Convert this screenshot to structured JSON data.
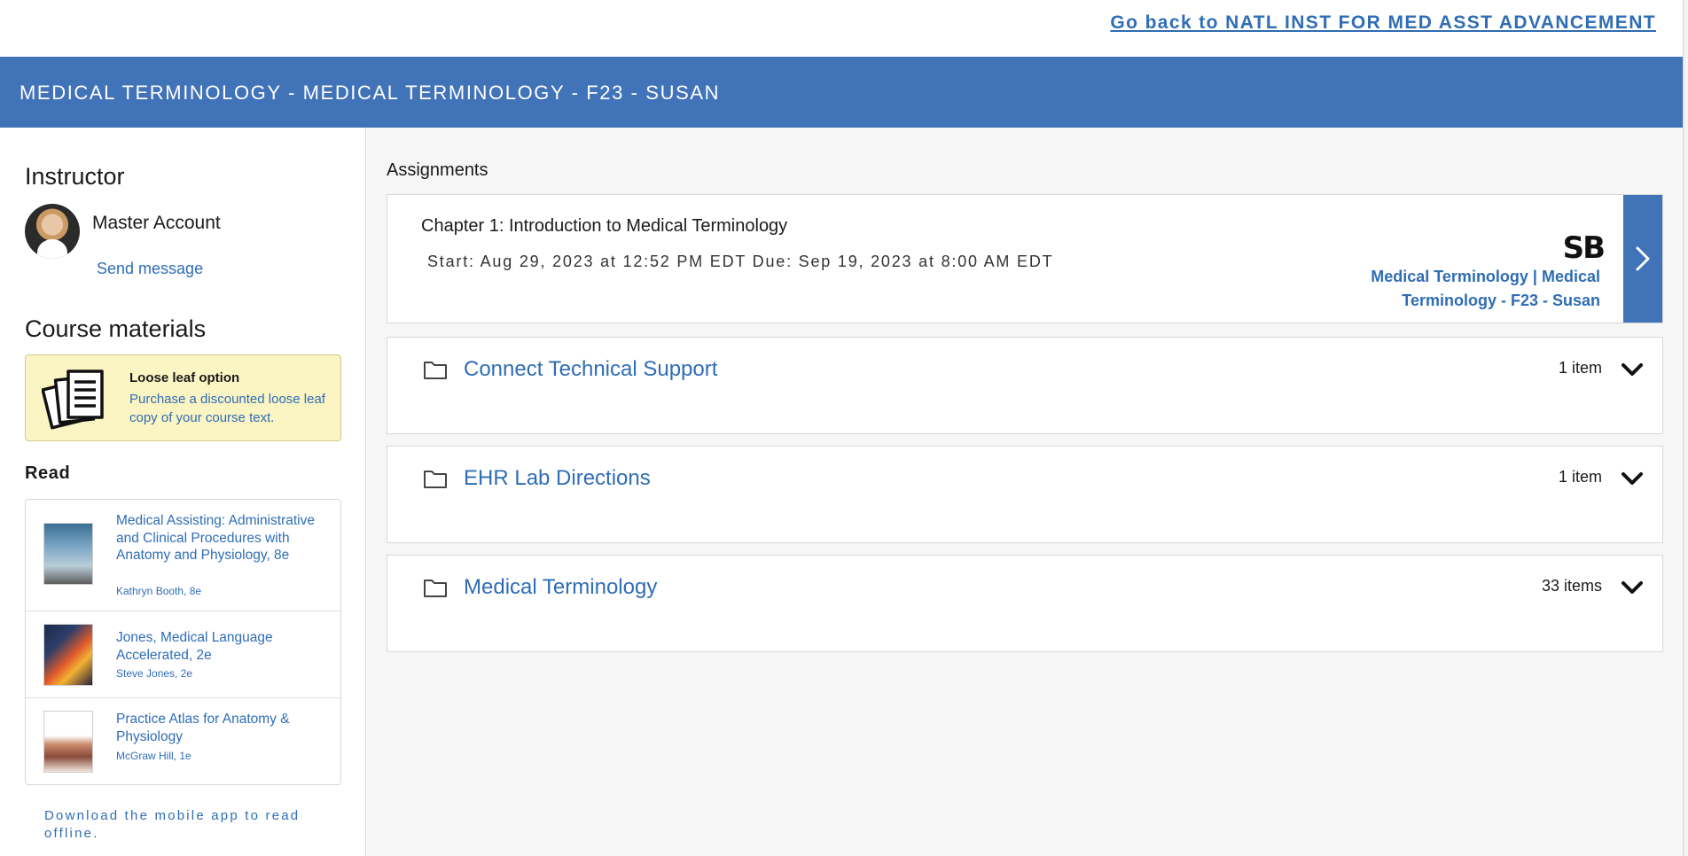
{
  "topbar": {
    "back_link": "Go back to NATL INST FOR MED ASST ADVANCEMENT"
  },
  "header": {
    "course_title": "MEDICAL TERMINOLOGY - MEDICAL TERMINOLOGY - F23 - SUSAN"
  },
  "sidebar": {
    "instructor": {
      "heading": "Instructor",
      "name": "Master Account",
      "send_message": "Send message",
      "avatar_icon": "instructor-avatar"
    },
    "course_materials": {
      "heading": "Course materials",
      "loose_leaf": {
        "icon": "loose-leaf-pages-icon",
        "heading": "Loose leaf option",
        "text": "Purchase a discounted loose leaf copy of your course text."
      }
    },
    "read": {
      "heading": "Read",
      "books": [
        {
          "title": "Medical Assisting: Administrative and Clinical Procedures with Anatomy and Physiology, 8e",
          "author": "Kathryn Booth, 8e",
          "cover_color": "#4a7fa8"
        },
        {
          "title": "Jones, Medical Language Accelerated, 2e",
          "author": "Steve Jones, 2e",
          "cover_color": "#c0392b"
        },
        {
          "title": "Practice Atlas for Anatomy & Physiology",
          "author": "McGraw Hill, 1e",
          "cover_color": "#2f6db5"
        }
      ]
    },
    "mobile_note": "Download the mobile app to read offline."
  },
  "main": {
    "assignments_label": "Assignments",
    "assignment": {
      "title": "Chapter 1: Introduction to Medical Terminology",
      "dates": "Start: Aug 29, 2023 at 12:52 PM EDT  Due: Sep 19, 2023 at 8:00 AM EDT",
      "logo": "SB",
      "course_link": "Medical Terminology | Medical Terminology - F23 - Susan",
      "arrow_icon": "chevron-right-icon"
    },
    "folders": [
      {
        "name": "Connect Technical Support",
        "count": "1 item"
      },
      {
        "name": "EHR Lab Directions",
        "count": "1 item"
      },
      {
        "name": "Medical Terminology",
        "count": "33 items"
      }
    ]
  },
  "colors": {
    "brand_blue": "#4173b8",
    "link_blue": "#2f6db5",
    "loose_leaf_bg": "#fbf4c3"
  }
}
